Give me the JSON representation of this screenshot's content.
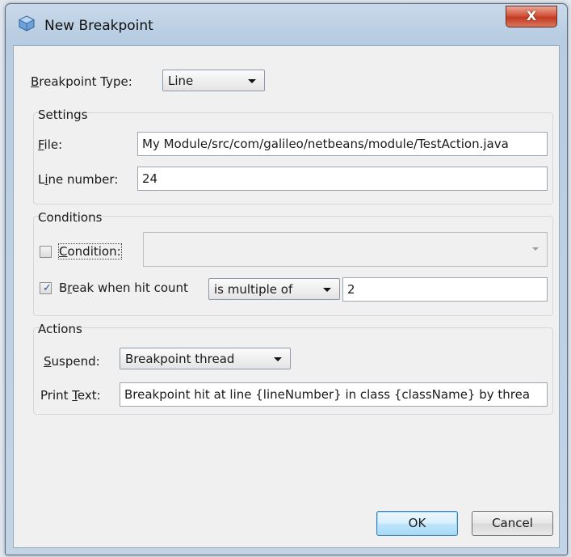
{
  "window": {
    "title": "New Breakpoint",
    "close_glyph": "X"
  },
  "breakpoint_type": {
    "label_prefix": "B",
    "label_rest": "reakpoint Type:",
    "value": "Line"
  },
  "settings": {
    "group_title": "Settings",
    "file_label_u": "F",
    "file_label_rest": "ile:",
    "file_value": "My Module/src/com/galileo/netbeans/module/TestAction.java",
    "line_label_a": "L",
    "line_label_u": "i",
    "line_label_rest": "ne number:",
    "line_value": "24"
  },
  "conditions": {
    "group_title": "Conditions",
    "condition_label_u": "C",
    "condition_label_rest": "ondition:",
    "condition_checked": false,
    "condition_value": "",
    "break_label_a": "B",
    "break_label_u": "r",
    "break_label_rest": "eak when hit count",
    "break_checked": true,
    "hitcount_mode": "is multiple of",
    "hitcount_value": "2"
  },
  "actions": {
    "group_title": "Actions",
    "suspend_label_u": "S",
    "suspend_label_rest": "uspend:",
    "suspend_value": "Breakpoint thread",
    "print_label_a": "Print ",
    "print_label_u": "T",
    "print_label_rest": "ext:",
    "print_value": "Breakpoint hit at line {lineNumber} in class {className} by threa"
  },
  "buttons": {
    "ok": "OK",
    "cancel": "Cancel"
  }
}
